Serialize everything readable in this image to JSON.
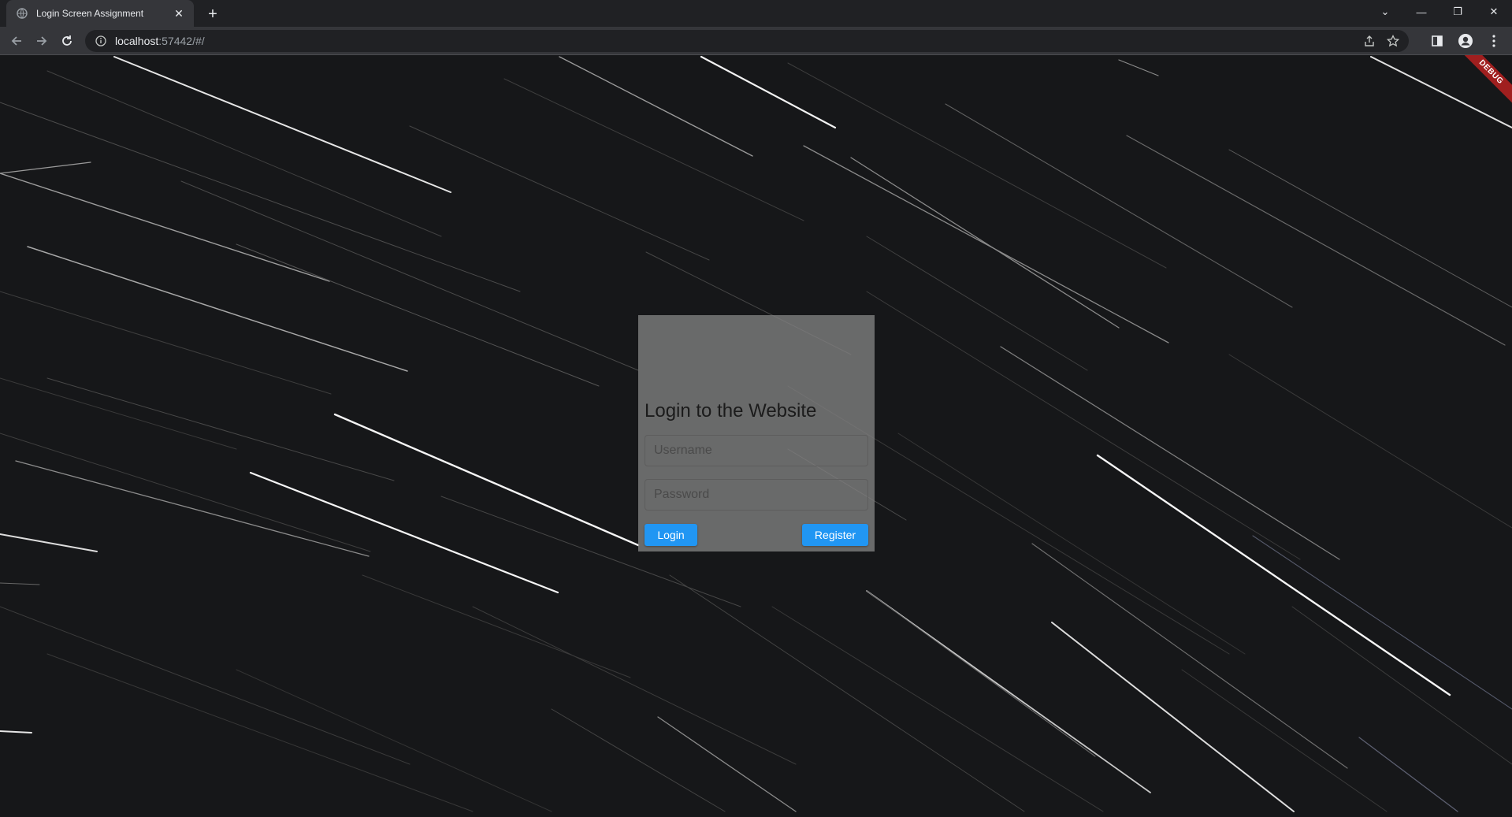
{
  "browser": {
    "tab_title": "Login Screen Assignment",
    "tab_close": "✕",
    "new_tab": "+",
    "url_host": "localhost",
    "url_rest": ":57442/#/"
  },
  "window_controls": {
    "tab_search": "⌄",
    "minimize": "—",
    "restore": "❐",
    "close": "✕"
  },
  "debug_banner": "DEBUG",
  "login": {
    "title": "Login to the Website",
    "username_placeholder": "Username",
    "password_placeholder": "Password",
    "login_label": "Login",
    "register_label": "Register",
    "button_color": "#2196f3"
  },
  "icons": {
    "favicon": "globe-icon",
    "back": "back-arrow-icon",
    "forward": "forward-arrow-icon",
    "reload": "reload-icon",
    "site_info": "info-icon",
    "share": "share-icon",
    "bookmark": "star-icon",
    "side_panel": "side-panel-icon",
    "profile": "profile-icon",
    "menu": "kebab-menu-icon"
  }
}
